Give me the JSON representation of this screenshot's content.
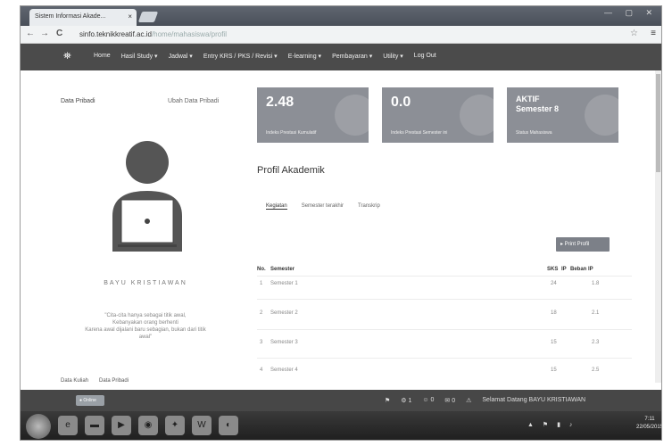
{
  "browser": {
    "tab_title": "Sistem Informasi Akade...",
    "tab_close": "×",
    "url": "sinfo.teknikkreatif.ac.id",
    "url_rest": "/home/mahasiswa/profil",
    "back": "←",
    "forward": "→",
    "reload": "C",
    "bookmark": "☆",
    "menu": "≡",
    "window_controls": "— ▢ ✕"
  },
  "nav": {
    "logo": "⛯",
    "items": [
      "Home",
      "Hasil Study ▾",
      "Jadwal ▾",
      "Entry KRS / PKS / Revisi ▾",
      "E-learning ▾",
      "Pembayaran ▾",
      "Utility ▾",
      "Log Out"
    ]
  },
  "profile": {
    "heading": "Data Pribadi",
    "edit_link": "Ubah Data Pribadi",
    "name": "BAYU KRISTIAWAN",
    "quote_lines": [
      "\"Cita-cita hanya sebagai titik awal,",
      "Kebanyakan orang berhenti",
      "Karena awal dijalani baru sebagian, bukan dari titik",
      "awal\""
    ],
    "footer_link1": "Data Kuliah",
    "footer_link2": "Data Pribadi"
  },
  "cards": [
    {
      "value": "2.48",
      "sub": "",
      "label": "Indeks Prestasi Kumulatif"
    },
    {
      "value": "0.0",
      "sub": "",
      "label": "Indeks Prestasi Semester ini"
    },
    {
      "value": "AKTIF",
      "sub": "Semester 8",
      "label": "Status Mahasiswa"
    }
  ],
  "section_title": "Profil Akademik",
  "tabs": [
    "Kegiatan",
    "Semester terakhir",
    "Transkrip"
  ],
  "export_label": "▸ Print Profil",
  "table": {
    "headers": [
      "No.",
      "Semester",
      "SKS",
      "IP",
      "Beban IP"
    ],
    "rows": [
      [
        "1",
        "Semester 1",
        "24",
        "1.8"
      ],
      [
        "2",
        "Semester 2",
        "18",
        "2.1"
      ],
      [
        "3",
        "Semester 3",
        "15",
        "2.3"
      ],
      [
        "4",
        "Semester 4",
        "15",
        "2.5"
      ]
    ]
  },
  "footbar": {
    "pill": "● Online",
    "stats": [
      "⚑",
      "⚙ 1",
      "☺ 0",
      "✉ 0",
      "⚠",
      "Selamat Datang BAYU KRISTIAWAN"
    ]
  },
  "taskbar": {
    "tray": "▲ ⚑ ▮ ♪",
    "time": "7:11",
    "date": "22/05/2015"
  }
}
